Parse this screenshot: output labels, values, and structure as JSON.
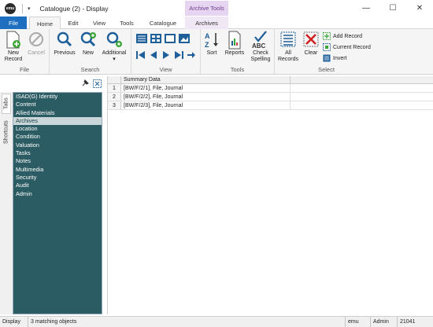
{
  "window": {
    "title": "Catalogue (2) - Display",
    "logo_text": "emu",
    "qa_dropdown": "▾",
    "controls": {
      "minimize": "—",
      "maximize": "☐",
      "close": "✕"
    }
  },
  "ribbon_tabs": {
    "context_header": "Archive Tools",
    "file": "File",
    "home": "Home",
    "edit": "Edit",
    "view": "View",
    "tools": "Tools",
    "catalogue": "Catalogue",
    "archives": "Archives"
  },
  "ribbon": {
    "file_group": {
      "label": "File",
      "new_record": "New Record",
      "cancel": "Cancel"
    },
    "search_group": {
      "label": "Search",
      "previous": "Previous",
      "new": "New",
      "additional": "Additional"
    },
    "view_group": {
      "label": "View"
    },
    "tools_group": {
      "label": "Tools",
      "sort": "Sort",
      "reports": "Reports",
      "check_spelling": "Check Spelling"
    },
    "select_group": {
      "label": "Select",
      "all_records": "All Records",
      "clear": "Clear",
      "add_record": "Add Record",
      "current_record": "Current Record",
      "invert": "Invert"
    }
  },
  "side_tabs": {
    "tabs": "Tabs",
    "shortcuts": "Shortcuts"
  },
  "tree": {
    "items": [
      "ISAD(G) Identity",
      "Content",
      "Allied Materials",
      "Archives",
      "Location",
      "Condition",
      "Valuation",
      "Tasks",
      "Notes",
      "Multimedia",
      "Security",
      "Audit",
      "Admin"
    ],
    "selected_index": 3
  },
  "grid": {
    "columns": [
      "Summary Data"
    ],
    "rows": [
      {
        "num": "1",
        "summary": "[BW/F/2/1], File, Journal"
      },
      {
        "num": "2",
        "summary": "[BW/F/2/2], File, Journal"
      },
      {
        "num": "3",
        "summary": "[BW/F/2/3], File, Journal"
      }
    ]
  },
  "status": {
    "mode": "Display",
    "matches": "3 matching objects",
    "db": "emu",
    "user": "Admin",
    "port": "21041"
  },
  "colors": {
    "file_tab": "#1e6fc0",
    "tree_bg": "#2b5b63",
    "context_tab": "#e6d4f0",
    "accent_green": "#3aa637",
    "accent_blue": "#1f5f9a"
  }
}
